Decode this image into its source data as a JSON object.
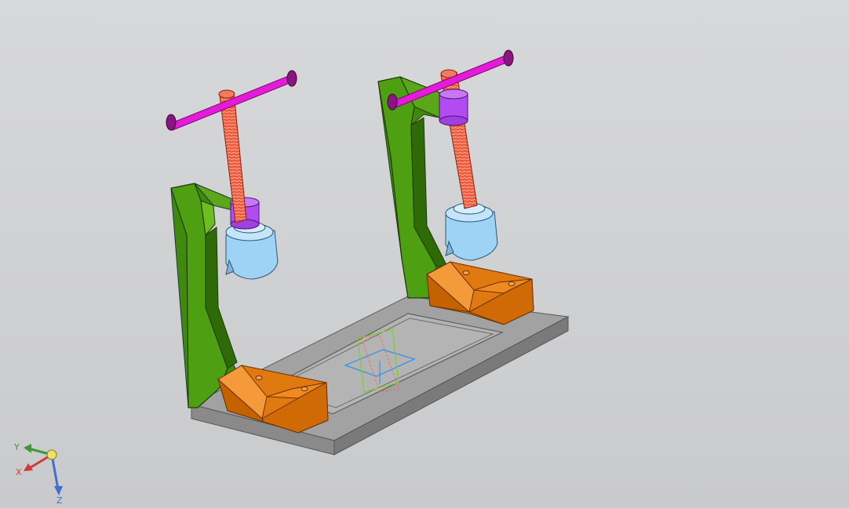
{
  "viewport": {
    "background_top": "#d7d8da",
    "background_bottom": "#c9cacc"
  },
  "axis_triad": {
    "x_label": "X",
    "y_label": "Y",
    "z_label": "Z",
    "x_color": "#d03a3a",
    "y_color": "#3a9a3a",
    "z_color": "#3f6fd1",
    "origin_color": "#f2e06a"
  },
  "model_colors": {
    "base_plate": "#9a9a9a",
    "frame": "#4f9f12",
    "v_block": "#e07a10",
    "screw": "#ee5a3c",
    "handle": "#e61bd9",
    "nut": "#b24cf0",
    "clamp_pad": "#9fd3f5"
  }
}
